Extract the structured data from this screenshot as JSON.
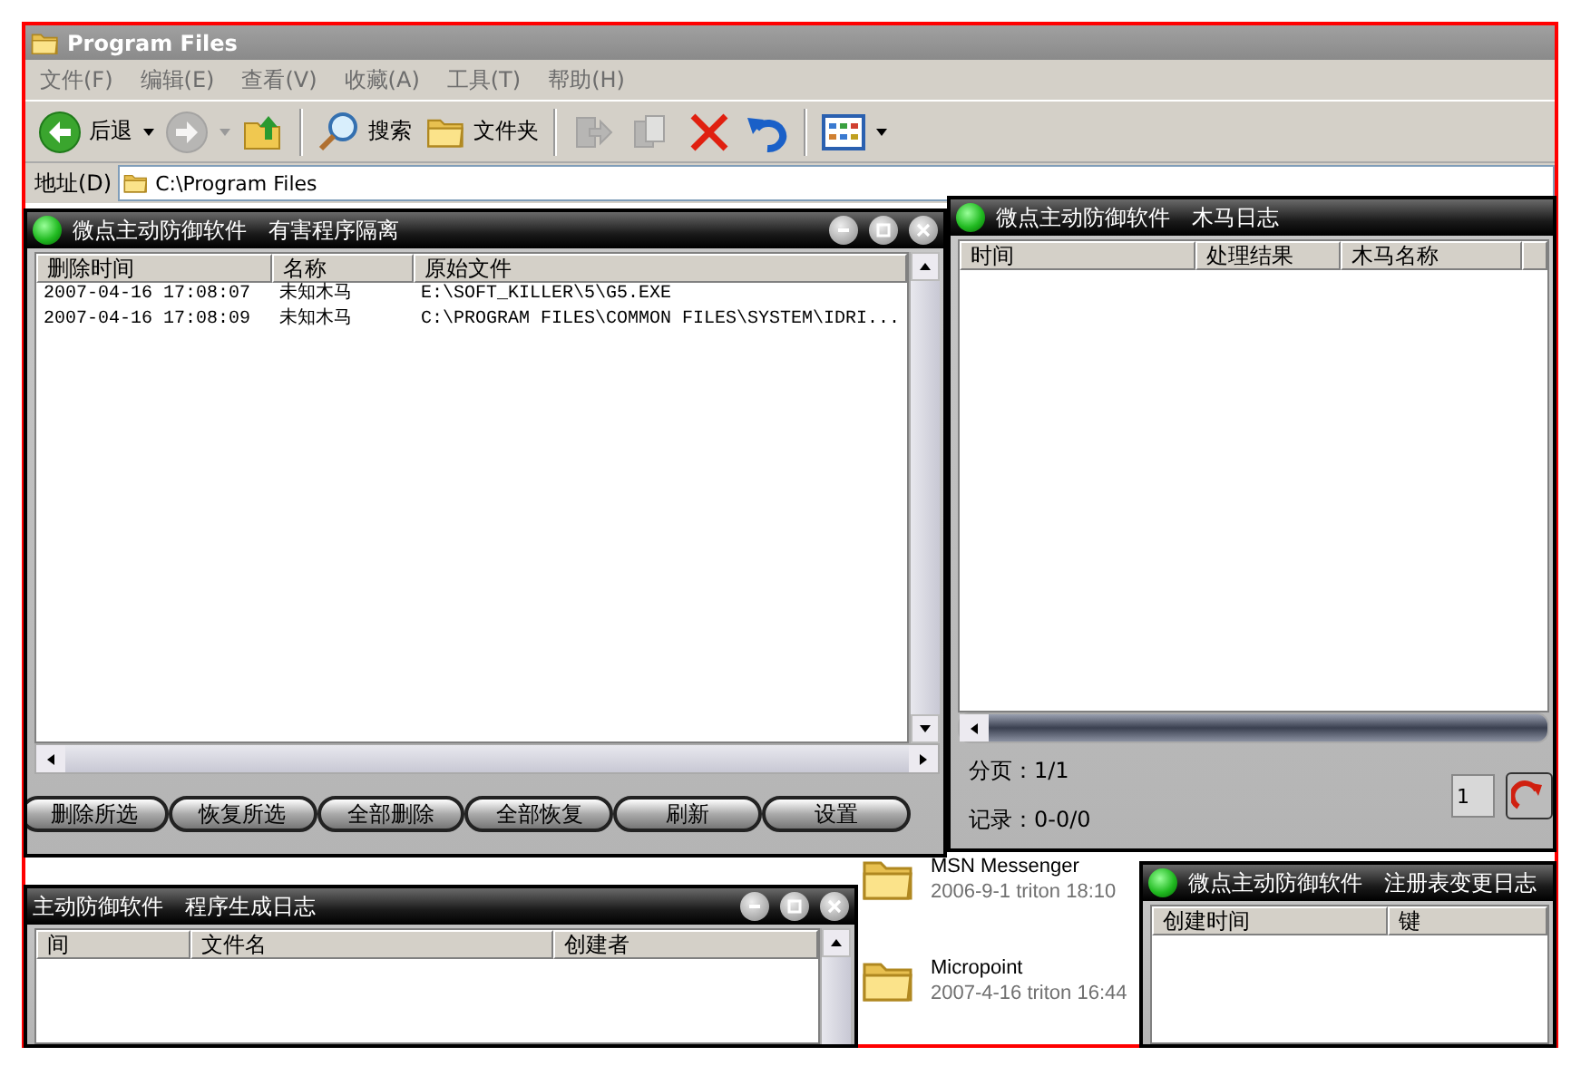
{
  "explorer": {
    "title": "Program Files",
    "menu": [
      "文件(F)",
      "编辑(E)",
      "查看(V)",
      "收藏(A)",
      "工具(T)",
      "帮助(H)"
    ],
    "toolbar": [
      {
        "kind": "back",
        "label": "后退",
        "disabled": false
      },
      {
        "kind": "forward",
        "disabled": true
      },
      {
        "kind": "up",
        "disabled": false
      },
      {
        "kind": "search",
        "label": "搜索",
        "disabled": false
      },
      {
        "kind": "folders",
        "label": "文件夹",
        "disabled": false
      },
      {
        "kind": "move",
        "disabled": true
      },
      {
        "kind": "copy",
        "disabled": true
      },
      {
        "kind": "delete",
        "disabled": false
      },
      {
        "kind": "undo",
        "disabled": false
      },
      {
        "kind": "views",
        "disabled": false
      }
    ],
    "address": {
      "label": "地址(D)",
      "value": "C:\\Program Files"
    },
    "items": [
      {
        "name": "MSN Messenger",
        "meta": "2006-9-1 triton 18:10"
      },
      {
        "name": "Micropoint",
        "meta": "2007-4-16 triton 16:44"
      }
    ]
  },
  "windows": [
    {
      "kind": "quarantine",
      "title": "微点主动防御软件　有害程序隔离",
      "columns": [
        "删除时间",
        "名称",
        "原始文件"
      ],
      "rows": [
        [
          "2007-04-16 17:08:07",
          "未知木马",
          "E:\\SOFT_KILLER\\5\\G5.EXE"
        ],
        [
          "2007-04-16 17:08:09",
          "未知木马",
          "C:\\PROGRAM FILES\\COMMON FILES\\SYSTEM\\IDRI..."
        ]
      ],
      "buttons": [
        "删除所选",
        "恢复所选",
        "全部删除",
        "全部恢复",
        "刷新",
        "设置"
      ]
    },
    {
      "kind": "trojan_log",
      "title": "微点主动防御软件　木马日志",
      "columns": [
        "时间",
        "处理结果",
        "木马名称"
      ],
      "pager": {
        "page": "分页：1/1",
        "records": "记录：0-0/0",
        "page_input": "1"
      }
    },
    {
      "kind": "registry_log",
      "title": "微点主动防御软件　注册表变更日志",
      "columns": [
        "创建时间",
        "键"
      ]
    },
    {
      "kind": "program_log",
      "title": "主动防御软件　程序生成日志",
      "columns": [
        "间",
        "文件名",
        "创建者"
      ]
    }
  ]
}
